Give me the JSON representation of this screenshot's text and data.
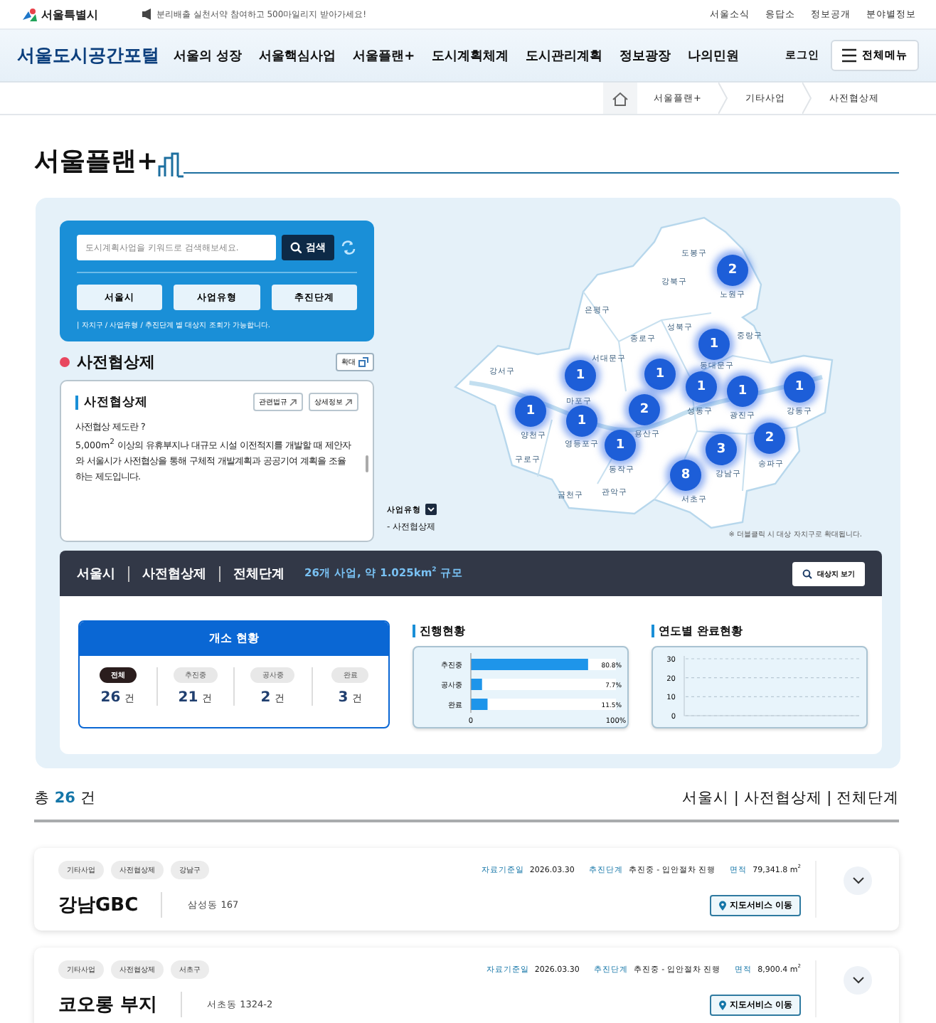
{
  "top_bar": {
    "logo": "서울특별시",
    "notice": "분리배출 실천서약 참여하고 500마일리지 받아가세요!",
    "links": [
      "서울소식",
      "응답소",
      "정보공개",
      "분야별정보"
    ]
  },
  "nav": {
    "site_title": "서울도시공간포털",
    "items": [
      "서울의 성장",
      "서울핵심사업",
      "서울플랜+",
      "도시계획체계",
      "도시관리계획",
      "정보광장",
      "나의민원"
    ],
    "login": "로그인",
    "all_menu": "전체메뉴"
  },
  "breadcrumb": [
    "서울플랜+",
    "기타사업",
    "사전협상제"
  ],
  "page_title": "서울플랜+",
  "search": {
    "placeholder": "도시계획사업을 키워드로 검색해보세요.",
    "button": "검색",
    "filters": [
      "서울시",
      "사업유형",
      "추진단계"
    ],
    "hint": "| 자치구 / 사업유형 / 추진단계 별 대상지 조회가 가능합니다."
  },
  "category": {
    "title": "사전협상제",
    "expand_button": "확대",
    "card": {
      "title": "사전협상제",
      "buttons": [
        "관련법규",
        "상세정보"
      ],
      "question": "사전협상 제도란 ?",
      "description": "5,000m$^{2}$ 이상의 유휴부지나 대규모 시설 이전적지를 개발할 때 제안자와 서울시가 사전협상을 통해 구체적 개발계획과 공공기여 계획을 조율하는 제도입니다."
    }
  },
  "map": {
    "districts": [
      "도봉구",
      "강북구",
      "노원구",
      "은평구",
      "성북구",
      "중랑구",
      "종로구",
      "서대문구",
      "동대문구",
      "강서구",
      "마포구",
      "양천구",
      "영등포구",
      "용산구",
      "성동구",
      "광진구",
      "강동구",
      "구로구",
      "동작구",
      "강남구",
      "송파구",
      "금천구",
      "관악구",
      "서초구"
    ],
    "markers": [
      {
        "count": "2"
      },
      {
        "count": "1"
      },
      {
        "count": "1"
      },
      {
        "count": "1"
      },
      {
        "count": "1"
      },
      {
        "count": "1"
      },
      {
        "count": "1"
      },
      {
        "count": "1"
      },
      {
        "count": "1"
      },
      {
        "count": "2"
      },
      {
        "count": "1"
      },
      {
        "count": "3"
      },
      {
        "count": "2"
      },
      {
        "count": "8"
      }
    ],
    "legend_title": "사업유형",
    "legend_item": "- 사전협상제",
    "note": "※ 더블클릭 시 대상 자치구로 확대됩니다."
  },
  "summary": {
    "filters": [
      "서울시",
      "사전협상제",
      "전체단계"
    ],
    "stats": "26개 사업, 약 1.025km$^{2}$ 규모",
    "view_button": "대상지 보기"
  },
  "count_card": {
    "title": "개소 현황",
    "tabs": [
      {
        "label": "전체",
        "count": "26",
        "unit": "건",
        "selected": true
      },
      {
        "label": "추진중",
        "count": "21",
        "unit": "건",
        "selected": false
      },
      {
        "label": "공사중",
        "count": "2",
        "unit": "건",
        "selected": false
      },
      {
        "label": "완료",
        "count": "3",
        "unit": "건",
        "selected": false
      }
    ]
  },
  "progress": {
    "title": "진행현황",
    "chart_data": {
      "type": "bar",
      "orientation": "horizontal",
      "categories": [
        "추진중",
        "공사중",
        "완료"
      ],
      "series": [
        {
          "color": "#1e95ea",
          "values": [
            80.8,
            7.7,
            11.5
          ]
        }
      ],
      "xlim": [
        0,
        100
      ],
      "xticks": [
        0,
        {
          "value": 100,
          "label": "100%"
        }
      ],
      "value_labels": [
        "80.8%",
        "7.7%",
        "11.5%"
      ]
    }
  },
  "yearly": {
    "title": "연도별 완료현황",
    "axis_labels": [
      "30",
      "20",
      "10",
      "0"
    ]
  },
  "results": {
    "total": "총 **26** 건",
    "filters": "서울시 | 사전협상제 | 전체단계"
  },
  "projects": [
    {
      "tags": [
        "기타사업",
        "사전협상제",
        "강남구"
      ],
      "name": "강남GBC",
      "address": "삼성동 167",
      "date_label": "자료기준일",
      "date": "2026.03.30",
      "stage_label": "추진단계",
      "stage": "추진중 - 입안절차 진행",
      "area_label": "면적",
      "area": "79,341.8 m$^{2}$",
      "map_button": "지도서비스 이동"
    },
    {
      "tags": [
        "기타사업",
        "사전협상제",
        "서초구"
      ],
      "name": "코오롱 부지",
      "address": "서초동 1324-2",
      "date_label": "자료기준일",
      "date": "2026.03.30",
      "stage_label": "추진단계",
      "stage": "추진중 - 입안절차 진행",
      "area_label": "면적",
      "area": "8,900.4 m$^{2}$",
      "map_button": "지도서비스 이동"
    }
  ]
}
